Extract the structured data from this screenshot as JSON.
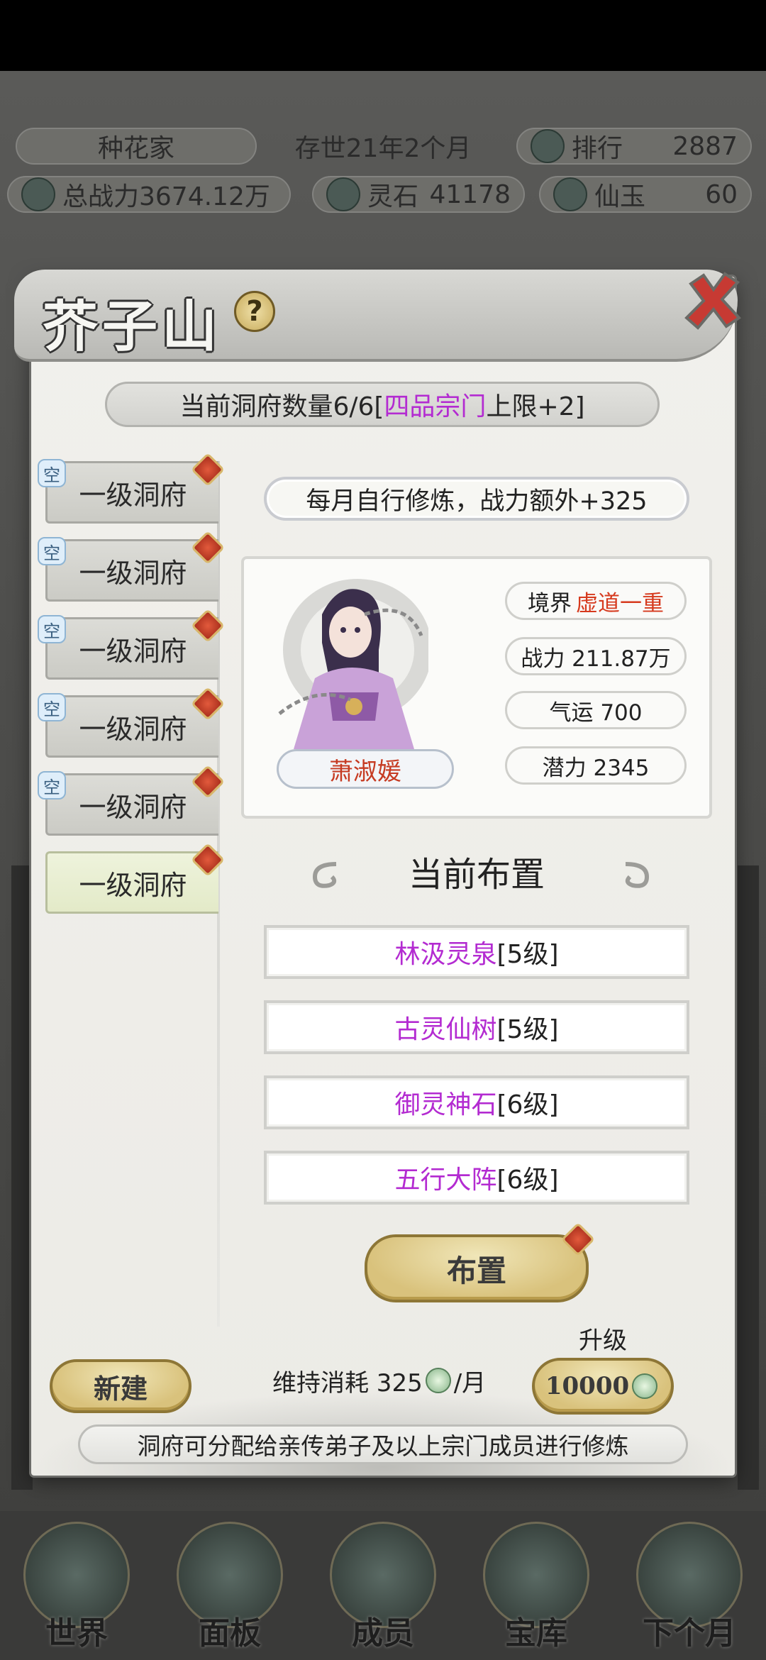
{
  "top_info": {
    "title_name": "种花家",
    "age": "存世21年2个月",
    "rank_label": "排行",
    "rank_value": "2887",
    "power_label": "总战力3674.12万",
    "spirit_stone_label": "灵石",
    "spirit_stone_value": "41178",
    "jade_label": "仙玉",
    "jade_value": "60"
  },
  "modal": {
    "title": "芥子山",
    "help_glyph": "?",
    "count_prefix": "当前洞府数量6/6[",
    "count_highlight": "四品宗门",
    "count_suffix": "上限+2]",
    "caves": [
      {
        "label": "一级洞府",
        "empty": "空"
      },
      {
        "label": "一级洞府",
        "empty": "空"
      },
      {
        "label": "一级洞府",
        "empty": "空"
      },
      {
        "label": "一级洞府",
        "empty": "空"
      },
      {
        "label": "一级洞府",
        "empty": "空"
      },
      {
        "label": "一级洞府",
        "empty": ""
      }
    ],
    "bonus_text": "每月自行修炼，战力额外+325",
    "disciple": {
      "name": "萧淑媛",
      "realm_label": "境界",
      "realm_value": "虚道一重",
      "power": "战力 211.87万",
      "luck": "气运 700",
      "potential": "潜力 2345"
    },
    "layout_title": "当前布置",
    "buildings": [
      {
        "name": "林汲灵泉",
        "level": "[5级]"
      },
      {
        "name": "古灵仙树",
        "level": "[5级]"
      },
      {
        "name": "御灵神石",
        "level": "[6级]"
      },
      {
        "name": "五行大阵",
        "level": "[6级]"
      }
    ],
    "arrange_button": "布置",
    "new_button": "新建",
    "maintenance_prefix": "维持消耗 325",
    "maintenance_suffix": "/月",
    "upgrade_label": "升级",
    "upgrade_cost": "10000",
    "footer_note": "洞府可分配给亲传弟子及以上宗门成员进行修炼"
  },
  "bottom_nav": [
    {
      "label": "世界"
    },
    {
      "label": "面板"
    },
    {
      "label": "成员"
    },
    {
      "label": "宝库"
    },
    {
      "label": "下个月"
    }
  ],
  "colors": {
    "highlight_purple": "#b32bd1",
    "highlight_red": "#d63a1e",
    "gold_button": "#d9c27c"
  }
}
